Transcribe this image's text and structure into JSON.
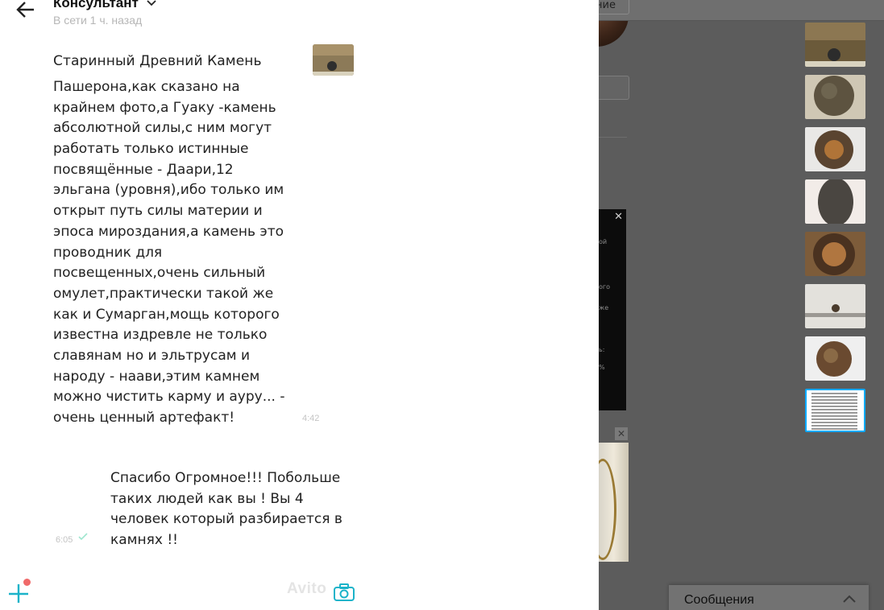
{
  "background": {
    "top_button_label": "ние",
    "dark_panel_fragments": [
      "ой",
      "ого",
      "же",
      "ь:",
      "%"
    ],
    "thumbnails": [
      {
        "icon": "stone-photo-1"
      },
      {
        "icon": "stone-photo-2"
      },
      {
        "icon": "stone-photo-3"
      },
      {
        "icon": "stone-photo-4"
      },
      {
        "icon": "stone-photo-5"
      },
      {
        "icon": "stone-photo-6"
      },
      {
        "icon": "stone-photo-7"
      },
      {
        "icon": "text-screenshot",
        "selected": true
      }
    ],
    "messages_bar": {
      "label": "Сообщения"
    }
  },
  "chat": {
    "contact_name": "Консультант",
    "status": "В сети 1 ч. назад",
    "messages": [
      {
        "item_title": "Старинный Древний Камень",
        "lines": [
          "Пашерона,как сказано на",
          "крайнем фото,а Гуаку -камень",
          "абсолютной силы,с ним могут",
          "работать только истинные",
          "посвящённые - Даари,12",
          "эльгана (уровня),ибо только им",
          "открыт путь силы материи и",
          "эпоса мироздания,а камень это",
          "проводник для",
          "посвещенных,очень сильный",
          "омулет,практически такой же",
          "как и Сумарган,мощь которого",
          "известна издревле не только",
          "славянам но и эльтрусам и",
          "народу - наави,этим камнем",
          "можно чистить карму и ауру... -",
          "очень ценный артефакт!"
        ],
        "time": "4:42"
      },
      {
        "lines": [
          "Спасибо Огромное!!! Побольше",
          "таких людей как вы ! Вы 4",
          "человек который разбирается в",
          "камнях !!"
        ],
        "time": "6:05"
      }
    ],
    "watermark": "Avito",
    "colors": {
      "accent": "#00aaff",
      "notify_dot": "#f06a6a",
      "read_check": "#9fe6cf"
    }
  }
}
